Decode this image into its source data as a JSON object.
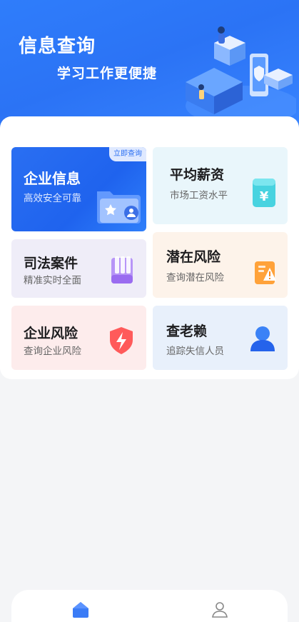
{
  "header": {
    "title": "信息查询",
    "subtitle": "学习工作更便捷"
  },
  "cards": {
    "company_info": {
      "title": "企业信息",
      "subtitle": "高效安全可靠",
      "tag": "立即查询",
      "icon": "folder-id-icon"
    },
    "avg_salary": {
      "title": "平均薪资",
      "subtitle": "市场工资水平",
      "icon": "yen-cup-icon"
    },
    "judicial": {
      "title": "司法案件",
      "subtitle": "精准实时全面",
      "icon": "files-icon"
    },
    "potential_risk": {
      "title": "潜在风险",
      "subtitle": "查询潜在风险",
      "icon": "warning-doc-icon"
    },
    "company_risk": {
      "title": "企业风险",
      "subtitle": "查询企业风险",
      "icon": "shield-bolt-icon"
    },
    "dishonest": {
      "title": "查老赖",
      "subtitle": "追踪失信人员",
      "icon": "person-icon"
    }
  },
  "tabbar": {
    "items": [
      {
        "icon": "home-icon",
        "active": true
      },
      {
        "icon": "user-icon",
        "active": false
      }
    ]
  },
  "colors": {
    "primary": "#2a6ff2",
    "hero": "#2f7dfb"
  }
}
